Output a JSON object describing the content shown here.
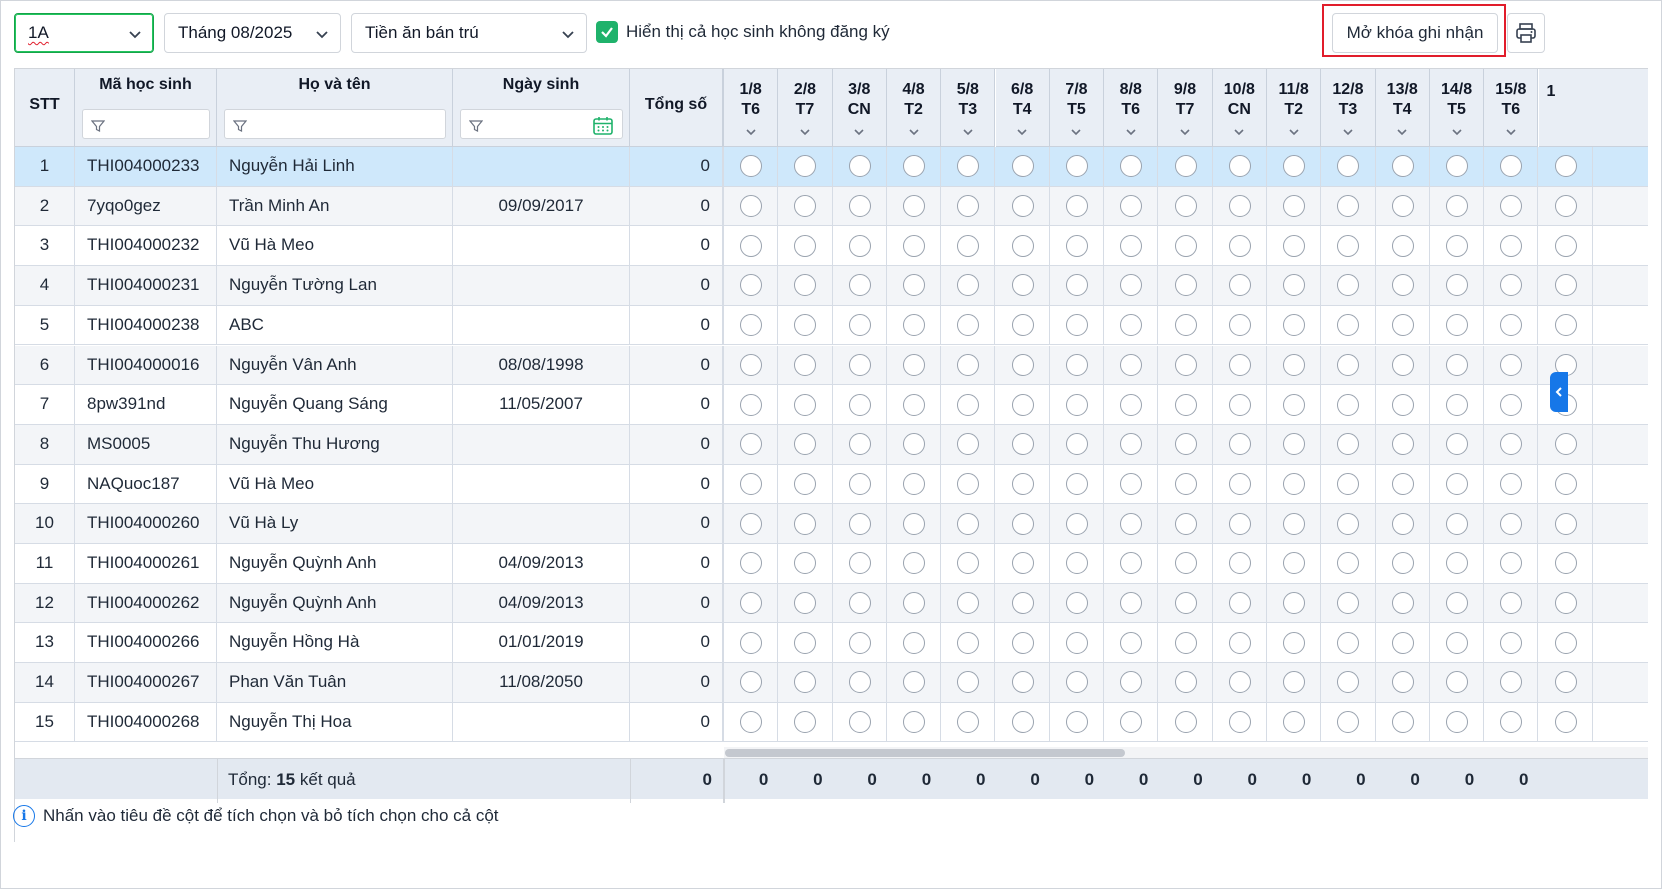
{
  "toolbar": {
    "class_select": "1A",
    "month_select": "Tháng 08/2025",
    "fee_select": "Tiền ăn bán trú",
    "show_unregistered_label": "Hiển thị cả học sinh không đăng ký",
    "show_unregistered_checked": true,
    "unlock_label": "Mở khóa ghi nhận",
    "print_icon": "printer-icon"
  },
  "columns": {
    "stt": "STT",
    "student_code": "Mã học sinh",
    "full_name": "Họ và tên",
    "birth_date": "Ngày sinh",
    "total": "Tổng số"
  },
  "days": [
    {
      "date": "1/8",
      "weekday": "T6"
    },
    {
      "date": "2/8",
      "weekday": "T7"
    },
    {
      "date": "3/8",
      "weekday": "CN"
    },
    {
      "date": "4/8",
      "weekday": "T2"
    },
    {
      "date": "5/8",
      "weekday": "T3"
    },
    {
      "date": "6/8",
      "weekday": "T4"
    },
    {
      "date": "7/8",
      "weekday": "T5"
    },
    {
      "date": "8/8",
      "weekday": "T6"
    },
    {
      "date": "9/8",
      "weekday": "T7"
    },
    {
      "date": "10/8",
      "weekday": "CN"
    },
    {
      "date": "11/8",
      "weekday": "T2"
    },
    {
      "date": "12/8",
      "weekday": "T3"
    },
    {
      "date": "13/8",
      "weekday": "T4"
    },
    {
      "date": "14/8",
      "weekday": "T5"
    },
    {
      "date": "15/8",
      "weekday": "T6"
    }
  ],
  "next_day_partial": "1",
  "rows": [
    {
      "stt": "1",
      "code": "THI004000233",
      "name": "Nguyễn Hải Linh",
      "dob": "",
      "total": "0"
    },
    {
      "stt": "2",
      "code": "7yqo0gez",
      "name": "Trần Minh An",
      "dob": "09/09/2017",
      "total": "0"
    },
    {
      "stt": "3",
      "code": "THI004000232",
      "name": "Vũ Hà Meo",
      "dob": "",
      "total": "0"
    },
    {
      "stt": "4",
      "code": "THI004000231",
      "name": "Nguyễn Tường Lan",
      "dob": "",
      "total": "0"
    },
    {
      "stt": "5",
      "code": "THI004000238",
      "name": "ABC",
      "dob": "",
      "total": "0"
    },
    {
      "stt": "6",
      "code": "THI004000016",
      "name": "Nguyễn Vân Anh",
      "dob": "08/08/1998",
      "total": "0"
    },
    {
      "stt": "7",
      "code": "8pw391nd",
      "name": "Nguyễn Quang Sáng",
      "dob": "11/05/2007",
      "total": "0"
    },
    {
      "stt": "8",
      "code": "MS0005",
      "name": "Nguyễn Thu Hương",
      "dob": "",
      "total": "0"
    },
    {
      "stt": "9",
      "code": "NAQuoc187",
      "name": "Vũ Hà Meo",
      "dob": "",
      "total": "0"
    },
    {
      "stt": "10",
      "code": "THI004000260",
      "name": "Vũ Hà Ly",
      "dob": "",
      "total": "0"
    },
    {
      "stt": "11",
      "code": "THI004000261",
      "name": "Nguyễn Quỳnh Anh",
      "dob": "04/09/2013",
      "total": "0"
    },
    {
      "stt": "12",
      "code": "THI004000262",
      "name": "Nguyễn Quỳnh Anh",
      "dob": "04/09/2013",
      "total": "0"
    },
    {
      "stt": "13",
      "code": "THI004000266",
      "name": "Nguyễn Hồng Hà",
      "dob": "01/01/2019",
      "total": "0"
    },
    {
      "stt": "14",
      "code": "THI004000267",
      "name": "Phan Văn Tuân",
      "dob": "11/08/2050",
      "total": "0"
    },
    {
      "stt": "15",
      "code": "THI004000268",
      "name": "Nguyễn Thị Hoa",
      "dob": "",
      "total": "0"
    }
  ],
  "footer": {
    "total_prefix": "Tổng:",
    "total_count": "15",
    "total_suffix": "kết quả",
    "sum_total": "0",
    "day_sums": [
      "0",
      "0",
      "0",
      "0",
      "0",
      "0",
      "0",
      "0",
      "0",
      "0",
      "0",
      "0",
      "0",
      "0",
      "0"
    ]
  },
  "hint": "Nhấn vào tiêu đề cột để tích chọn và bỏ tích chọn cho cả cột",
  "colors": {
    "accent_green": "#1fb26b",
    "accent_blue": "#1677e8",
    "highlight_red": "#e11d2b",
    "selected_row": "#cfe8fb"
  }
}
